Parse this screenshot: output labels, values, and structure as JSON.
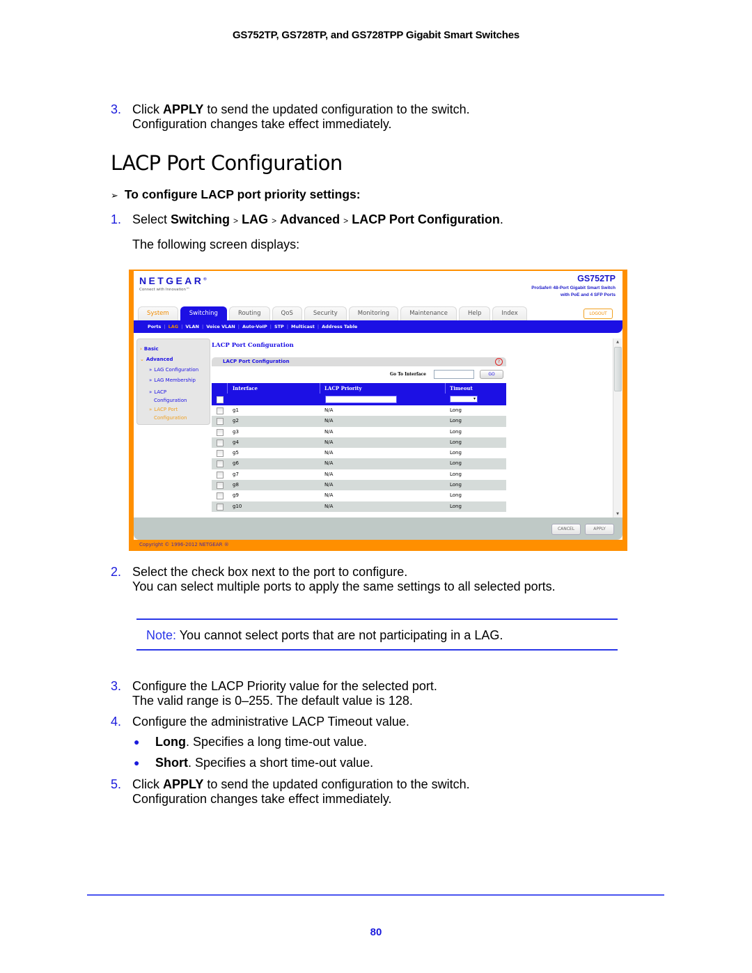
{
  "page": {
    "running_head": "GS752TP, GS728TP, and GS728TPP Gigabit Smart Switches",
    "intro_step": {
      "num": "3.",
      "pre": "Click ",
      "bold": "APPLY",
      "post": " to send the updated configuration to the switch.",
      "line2": "Configuration changes take effect immediately."
    },
    "section_title": "LACP Port Configuration",
    "procedure_heading": "To configure LACP port priority settings:",
    "procedure_arrow": "➢",
    "step1": {
      "num": "1.",
      "pre": "Select ",
      "path": [
        "Switching",
        "LAG",
        "Advanced",
        "LACP Port Configuration"
      ],
      "sep": ">",
      "post": ".",
      "line2": "The following screen displays:"
    },
    "step2": {
      "num": "2.",
      "line1": "Select the check box next to the port to configure.",
      "line2": "You can select multiple ports to apply the same settings to all selected ports."
    },
    "note": {
      "label": "Note:",
      "text": " You cannot select ports that are not participating in a LAG."
    },
    "step3": {
      "num": "3.",
      "line1": "Configure the LACP Priority value for the selected port.",
      "line2": "The valid range is 0–255. The default value is 128."
    },
    "step4": {
      "num": "4.",
      "line1": "Configure the administrative LACP Timeout value."
    },
    "bullets": [
      {
        "bold": "Long",
        "text": ". Specifies a long time-out value."
      },
      {
        "bold": "Short",
        "text": ". Specifies a short time-out value."
      }
    ],
    "step5": {
      "num": "5.",
      "pre": "Click ",
      "bold": "APPLY",
      "post": " to send the updated configuration to the switch.",
      "line2": "Configuration changes take effect immediately."
    },
    "page_number": "80"
  },
  "ui": {
    "logo": "NETGEAR",
    "logo_mark": "®",
    "tagline": "Connect with Innovation™",
    "model": "GS752TP",
    "model_desc1": "ProSafe® 48-Port Gigabit Smart Switch",
    "model_desc2": "with PoE and 4 SFP Ports",
    "tabs": [
      "System",
      "Switching",
      "Routing",
      "QoS",
      "Security",
      "Monitoring",
      "Maintenance",
      "Help",
      "Index"
    ],
    "active_tab": "Switching",
    "logout": "LOGOUT",
    "subnav": [
      "Ports",
      "LAG",
      "VLAN",
      "Voice VLAN",
      "Auto-VoIP",
      "STP",
      "Multicast",
      "Address Table"
    ],
    "active_subnav": "LAG",
    "sidebar": {
      "basic": "Basic",
      "advanced": "Advanced",
      "items": [
        "LAG Configuration",
        "LAG Membership",
        "LACP",
        "Configuration",
        "LACP Port",
        "Configuration"
      ]
    },
    "content_title": "LACP Port Configuration",
    "panel_title": "LACP Port Configuration",
    "help_icon": "?",
    "goto_label": "Go To Interface",
    "goto_value": "",
    "go_button": "GO",
    "columns": [
      "Interface",
      "LACP Priority",
      "Timeout"
    ],
    "priority_input_value": "",
    "timeout_select_value": "",
    "rows": [
      {
        "interface": "g1",
        "priority": "N/A",
        "timeout": "Long"
      },
      {
        "interface": "g2",
        "priority": "N/A",
        "timeout": "Long"
      },
      {
        "interface": "g3",
        "priority": "N/A",
        "timeout": "Long"
      },
      {
        "interface": "g4",
        "priority": "N/A",
        "timeout": "Long"
      },
      {
        "interface": "g5",
        "priority": "N/A",
        "timeout": "Long"
      },
      {
        "interface": "g6",
        "priority": "N/A",
        "timeout": "Long"
      },
      {
        "interface": "g7",
        "priority": "N/A",
        "timeout": "Long"
      },
      {
        "interface": "g8",
        "priority": "N/A",
        "timeout": "Long"
      },
      {
        "interface": "g9",
        "priority": "N/A",
        "timeout": "Long"
      },
      {
        "interface": "g10",
        "priority": "N/A",
        "timeout": "Long"
      }
    ],
    "cancel_button": "CANCEL",
    "apply_button": "APPLY",
    "copyright": "Copyright © 1996-2012 NETGEAR ®",
    "colors": {
      "brand_blue": "#1c10e4",
      "orange": "#ff8f00",
      "doc_blue": "#1a1adc"
    }
  }
}
